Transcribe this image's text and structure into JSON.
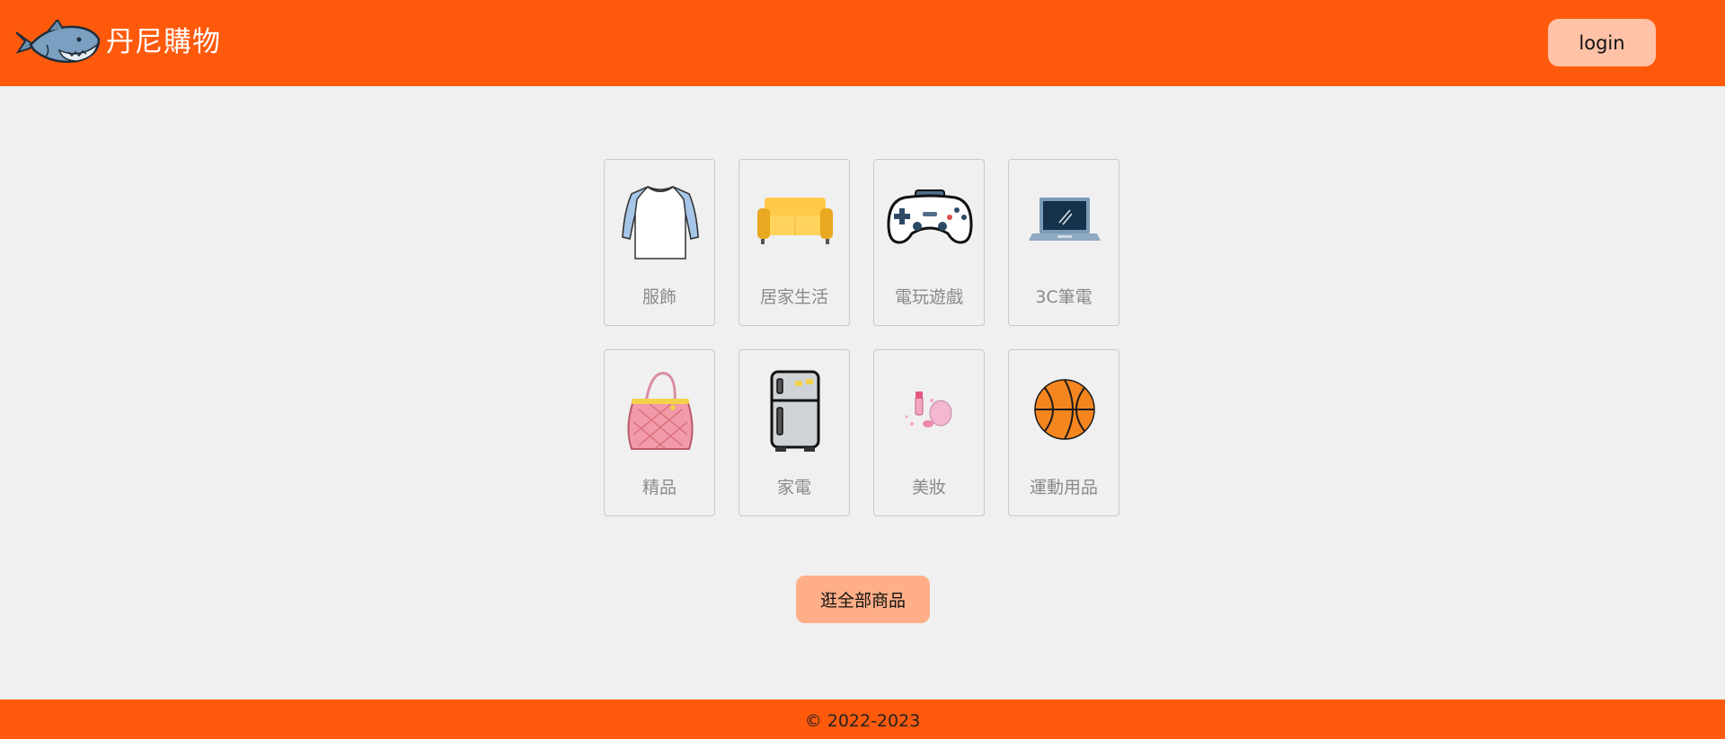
{
  "header": {
    "logo_icon": "shark-icon",
    "brand": "丹尼購物",
    "login_label": "login",
    "background_color": "#ff5a0c"
  },
  "categories": [
    {
      "label": "服飾",
      "icon": "tshirt-icon"
    },
    {
      "label": "居家生活",
      "icon": "sofa-icon"
    },
    {
      "label": "電玩遊戲",
      "icon": "gamepad-icon"
    },
    {
      "label": "3C筆電",
      "icon": "laptop-icon"
    },
    {
      "label": "精品",
      "icon": "handbag-icon"
    },
    {
      "label": "家電",
      "icon": "refrigerator-icon"
    },
    {
      "label": "美妝",
      "icon": "cosmetics-icon"
    },
    {
      "label": "運動用品",
      "icon": "basketball-icon"
    }
  ],
  "browse_all_label": "逛全部商品",
  "footer": {
    "copyright": "© 2022-2023"
  },
  "colors": {
    "accent": "#ff5a0c",
    "login_button": "#ffc2a6",
    "browse_button": "#ffae88",
    "page_background": "#f0f0f0"
  }
}
